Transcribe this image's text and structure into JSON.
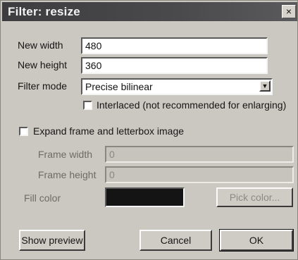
{
  "window": {
    "title": "Filter: resize",
    "close_glyph": "×"
  },
  "form": {
    "new_width_label": "New width",
    "new_width_value": "480",
    "new_height_label": "New height",
    "new_height_value": "360",
    "filter_mode_label": "Filter mode",
    "filter_mode_value": "Precise bilinear",
    "interlaced_label": "Interlaced (not recommended for enlarging)",
    "interlaced_checked": false,
    "expand_label": "Expand frame and letterbox image",
    "expand_checked": false,
    "frame_width_label": "Frame width",
    "frame_width_value": "0",
    "frame_height_label": "Frame height",
    "frame_height_value": "0",
    "fill_color_label": "Fill color",
    "fill_color": "#141414",
    "pick_color_label": "Pick color..."
  },
  "buttons": {
    "show_preview": "Show preview",
    "cancel": "Cancel",
    "ok": "OK"
  },
  "icons": {
    "dropdown_arrow": "chevron-down-icon",
    "close": "close-icon"
  }
}
